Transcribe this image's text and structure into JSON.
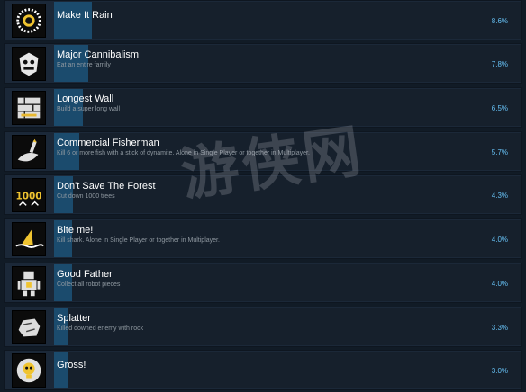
{
  "achievements": [
    {
      "title": "Make It Rain",
      "description": "",
      "percent": "8.6%",
      "percent_value": 8.6,
      "icon": "sun-burst-icon"
    },
    {
      "title": "Major Cannibalism",
      "description": "Eat an entire family",
      "percent": "7.8%",
      "percent_value": 7.8,
      "icon": "tribal-mask-icon"
    },
    {
      "title": "Longest Wall",
      "description": "Build a super long wall",
      "percent": "6.5%",
      "percent_value": 6.5,
      "icon": "wall-icon"
    },
    {
      "title": "Commercial Fisherman",
      "description": "Kill 6 or more fish with a stick of dynamite. Alone in Single Player or together in Multiplayer.",
      "percent": "5.7%",
      "percent_value": 5.7,
      "icon": "dynamite-fish-icon"
    },
    {
      "title": "Don't Save The Forest",
      "description": "Cut down 1000 trees",
      "percent": "4.3%",
      "percent_value": 4.3,
      "icon": "1000-trees-icon"
    },
    {
      "title": "Bite me!",
      "description": "Kill shark. Alone in Single Player or together in Multiplayer.",
      "percent": "4.0%",
      "percent_value": 4.0,
      "icon": "shark-fin-icon"
    },
    {
      "title": "Good Father",
      "description": "Collect all robot pieces",
      "percent": "4.0%",
      "percent_value": 4.0,
      "icon": "robot-icon"
    },
    {
      "title": "Splatter",
      "description": "Killed downed enemy with rock",
      "percent": "3.3%",
      "percent_value": 3.3,
      "icon": "rock-icon"
    },
    {
      "title": "Gross!",
      "description": "",
      "percent": "3.0%",
      "percent_value": 3.0,
      "icon": "skull-badge-icon"
    }
  ],
  "watermark": "游侠网",
  "colors": {
    "bar": "#1b4b6d",
    "percent": "#66c0f4",
    "row": "#1b2838"
  }
}
